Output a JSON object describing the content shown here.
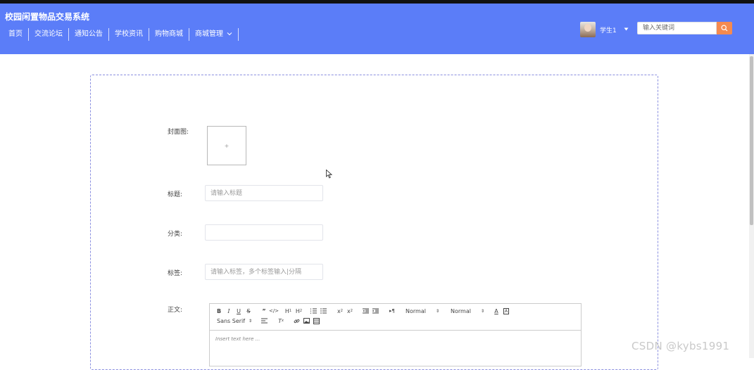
{
  "header": {
    "site_title": "校园闲置物品交易系统",
    "nav": [
      {
        "label": "首页"
      },
      {
        "label": "交流论坛"
      },
      {
        "label": "通知公告"
      },
      {
        "label": "学校资讯"
      },
      {
        "label": "购物商城"
      },
      {
        "label": "商城管理"
      }
    ],
    "user": {
      "name": "学生1"
    },
    "search": {
      "placeholder": "输入关键词"
    }
  },
  "form": {
    "cover_label": "封面图:",
    "cover_upload_glyph": "+",
    "title_label": "标题:",
    "title_placeholder": "请输入标题",
    "category_label": "分类:",
    "category_value": "",
    "tags_label": "标签:",
    "tags_placeholder": "请输入标签，多个标签输入|分隔",
    "body_label": "正文:"
  },
  "editor": {
    "header_select": "Normal",
    "size_select": "Normal",
    "font_select": "Sans Serif",
    "placeholder": "Insert text here ..."
  },
  "watermark": "CSDN @kybs1991",
  "colors": {
    "header_bg": "#5b7df8",
    "search_button": "#f58a4f",
    "panel_border": "#8a8fe0"
  }
}
